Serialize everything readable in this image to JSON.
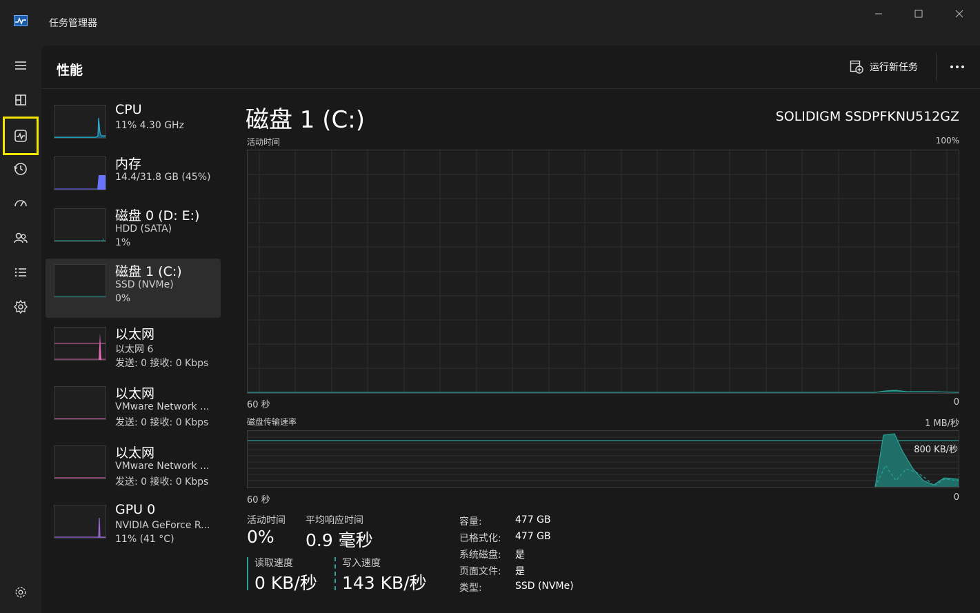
{
  "window": {
    "title": "任务管理器"
  },
  "header": {
    "title": "性能",
    "run_task_label": "运行新任务"
  },
  "colors": {
    "accent_disk": "#2aa198",
    "accent_mem": "#6a73ff",
    "accent_eth": "#e06ab4",
    "accent_gpu": "#9b6be0",
    "accent_cpu": "#2ab6d9",
    "highlight": "#f2e600"
  },
  "nav": [
    {
      "icon": "hamburger-icon"
    },
    {
      "icon": "processes-icon"
    },
    {
      "icon": "performance-icon",
      "active": true
    },
    {
      "icon": "app-history-icon"
    },
    {
      "icon": "startup-icon"
    },
    {
      "icon": "users-icon"
    },
    {
      "icon": "details-icon"
    },
    {
      "icon": "services-icon"
    },
    {
      "icon": "settings-icon"
    }
  ],
  "devices": [
    {
      "name": "CPU",
      "sub": "11%  4.30 GHz",
      "sub2": ""
    },
    {
      "name": "内存",
      "sub": "14.4/31.8 GB (45%)",
      "sub2": ""
    },
    {
      "name": "磁盘 0 (D: E:)",
      "sub": "HDD (SATA)",
      "sub2": "1%"
    },
    {
      "name": "磁盘 1 (C:)",
      "sub": "SSD (NVMe)",
      "sub2": "0%",
      "selected": true
    },
    {
      "name": "以太网",
      "sub": "以太网 6",
      "sub2": "发送: 0 接收: 0 Kbps"
    },
    {
      "name": "以太网",
      "sub": "VMware Network ...",
      "sub2": "发送: 0 接收: 0 Kbps"
    },
    {
      "name": "以太网",
      "sub": "VMware Network ...",
      "sub2": "发送: 0 接收: 0 Kbps"
    },
    {
      "name": "GPU 0",
      "sub": "NVIDIA GeForce R...",
      "sub2": "11% (41 °C)"
    }
  ],
  "detail": {
    "title": "磁盘 1 (C:)",
    "model": "SOLIDIGM SSDPFKNU512GZ",
    "active_time_graph": {
      "label": "活动时间",
      "max": "100%",
      "x_left": "60 秒",
      "x_right": "0"
    },
    "transfer_graph": {
      "label": "磁盘传输速率",
      "max": "1 MB/秒",
      "marker": "800 KB/秒",
      "x_left": "60 秒",
      "x_right": "0"
    },
    "stats": {
      "active_time_label": "活动时间",
      "active_time_value": "0%",
      "avg_response_label": "平均响应时间",
      "avg_response_value": "0.9 毫秒",
      "read_label": "读取速度",
      "read_value": "0 KB/秒",
      "write_label": "写入速度",
      "write_value": "143 KB/秒"
    },
    "props": [
      {
        "k": "容量:",
        "v": "477 GB"
      },
      {
        "k": "已格式化:",
        "v": "477 GB"
      },
      {
        "k": "系统磁盘:",
        "v": "是"
      },
      {
        "k": "页面文件:",
        "v": "是"
      },
      {
        "k": "类型:",
        "v": "SSD (NVMe)"
      }
    ]
  }
}
